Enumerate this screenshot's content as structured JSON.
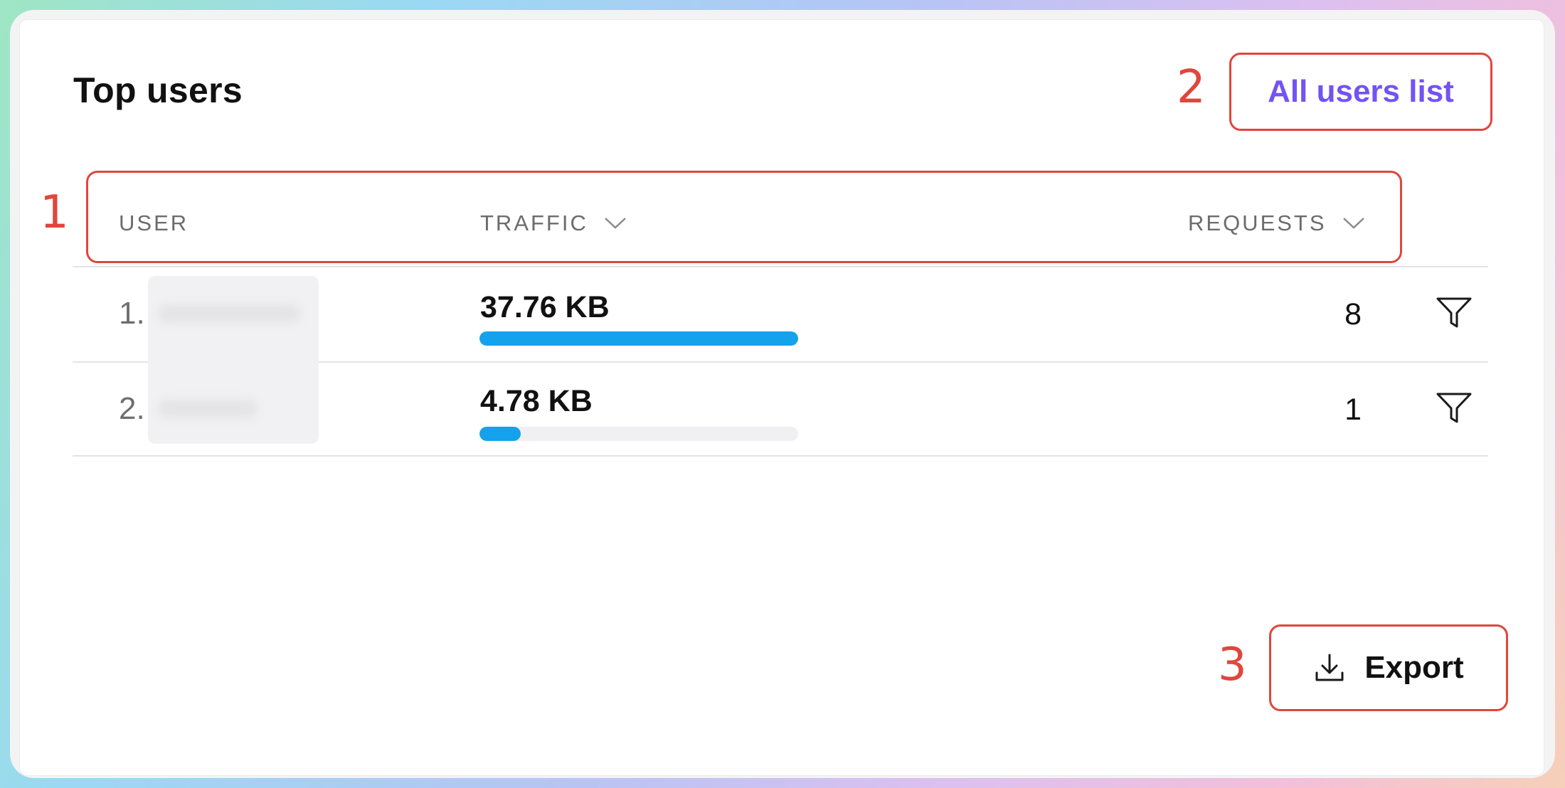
{
  "card": {
    "title": "Top users",
    "all_users_link": "All users list",
    "export_label": "Export"
  },
  "annotations": [
    "1",
    "2",
    "3"
  ],
  "table": {
    "columns": [
      {
        "label": "USER",
        "sortable": false
      },
      {
        "label": "TRAFFIC",
        "sortable": true,
        "icon": "chevron-down-icon"
      },
      {
        "label": "REQUESTS",
        "sortable": true,
        "icon": "chevron-down-icon"
      }
    ],
    "rows": [
      {
        "rank": "1.",
        "user": "",
        "traffic": "37.76 KB",
        "traffic_fraction": 1.0,
        "requests": "8",
        "action_icon": "filter-icon"
      },
      {
        "rank": "2.",
        "user": "",
        "traffic": "4.78 KB",
        "traffic_fraction": 0.13,
        "requests": "1",
        "action_icon": "filter-icon"
      }
    ]
  },
  "colors": {
    "link": "#7353f2",
    "bar": "#14a2ec",
    "annotation": "#e0463c"
  },
  "icons": [
    "chevron-down-icon",
    "filter-icon",
    "download-icon"
  ]
}
